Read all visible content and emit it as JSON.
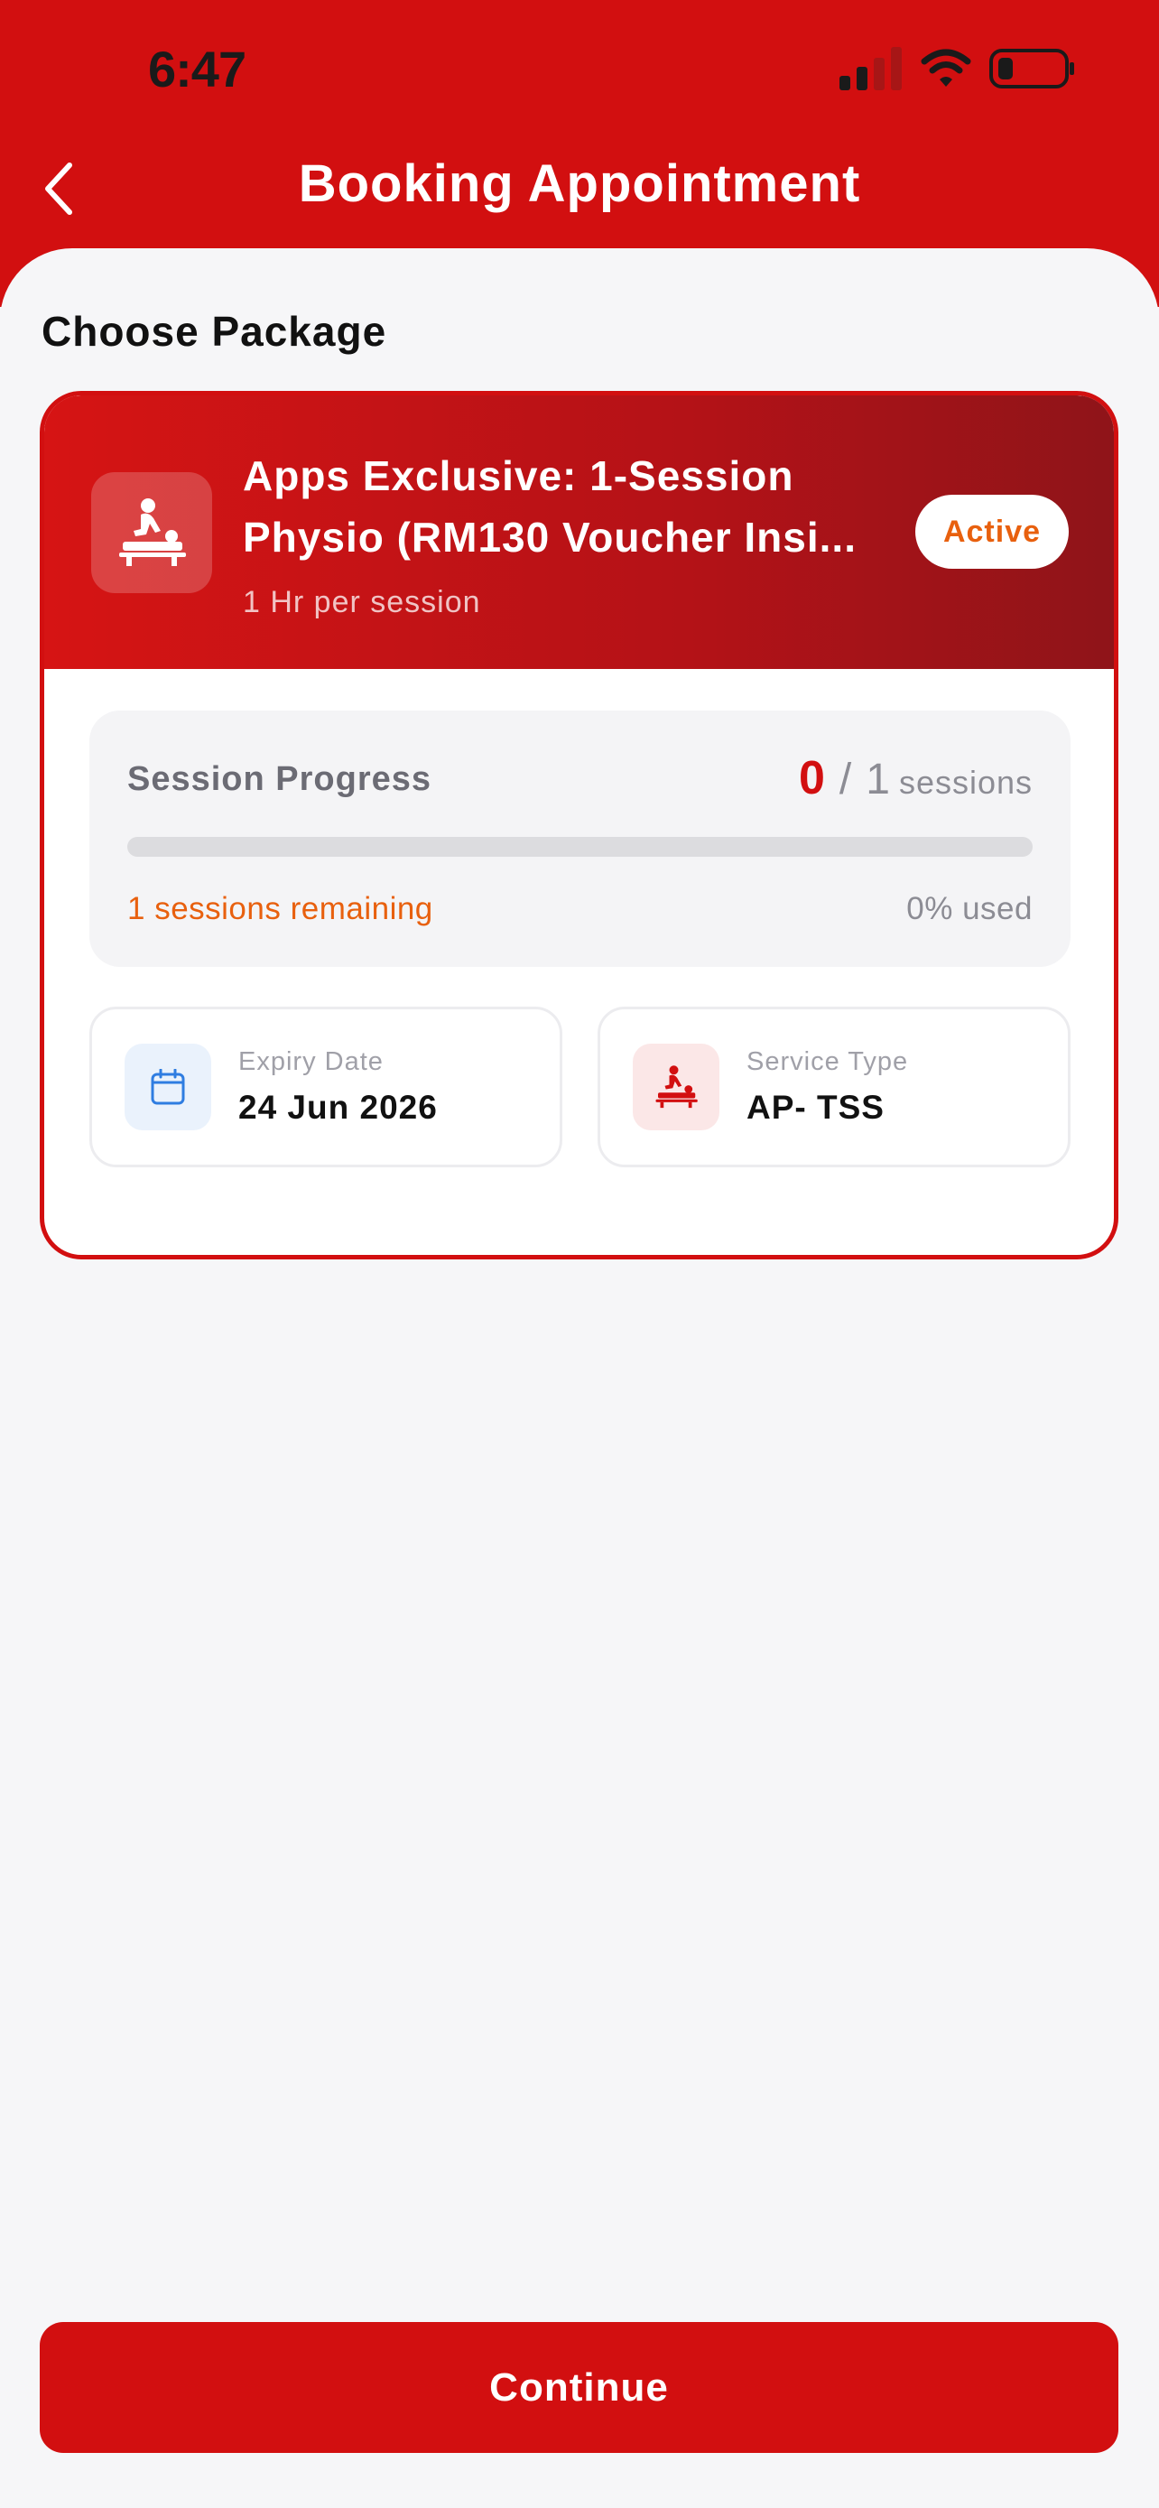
{
  "status_bar": {
    "time": "6:47",
    "signal_icon": "cellular-signal-icon",
    "wifi_icon": "wifi-icon",
    "battery_icon": "battery-low-icon"
  },
  "header": {
    "title": "Booking Appointment",
    "back_icon": "chevron-left-icon",
    "background_color": "#d20f10"
  },
  "section": {
    "title": "Choose Package"
  },
  "package": {
    "name_line1": "Apps Exclusive: 1-Session",
    "name_line2": "Physio (RM130 Voucher Insi...",
    "duration": "1 Hr per session",
    "status": "Active",
    "icon": "massage-therapy-icon",
    "progress": {
      "label": "Session Progress",
      "used": "0",
      "separator": "/",
      "total": "1",
      "unit": "sessions",
      "used_fraction": 0,
      "remaining_text": "1 sessions remaining",
      "used_percent_text": "0% used"
    },
    "expiry": {
      "icon": "calendar-icon",
      "label": "Expiry Date",
      "value": "24 Jun 2026"
    },
    "service": {
      "icon": "massage-therapy-icon",
      "label": "Service Type",
      "value": "AP- TSS"
    }
  },
  "footer": {
    "continue_label": "Continue"
  },
  "colors": {
    "brand_red": "#d20f10",
    "accent_orange": "#e8600e"
  }
}
